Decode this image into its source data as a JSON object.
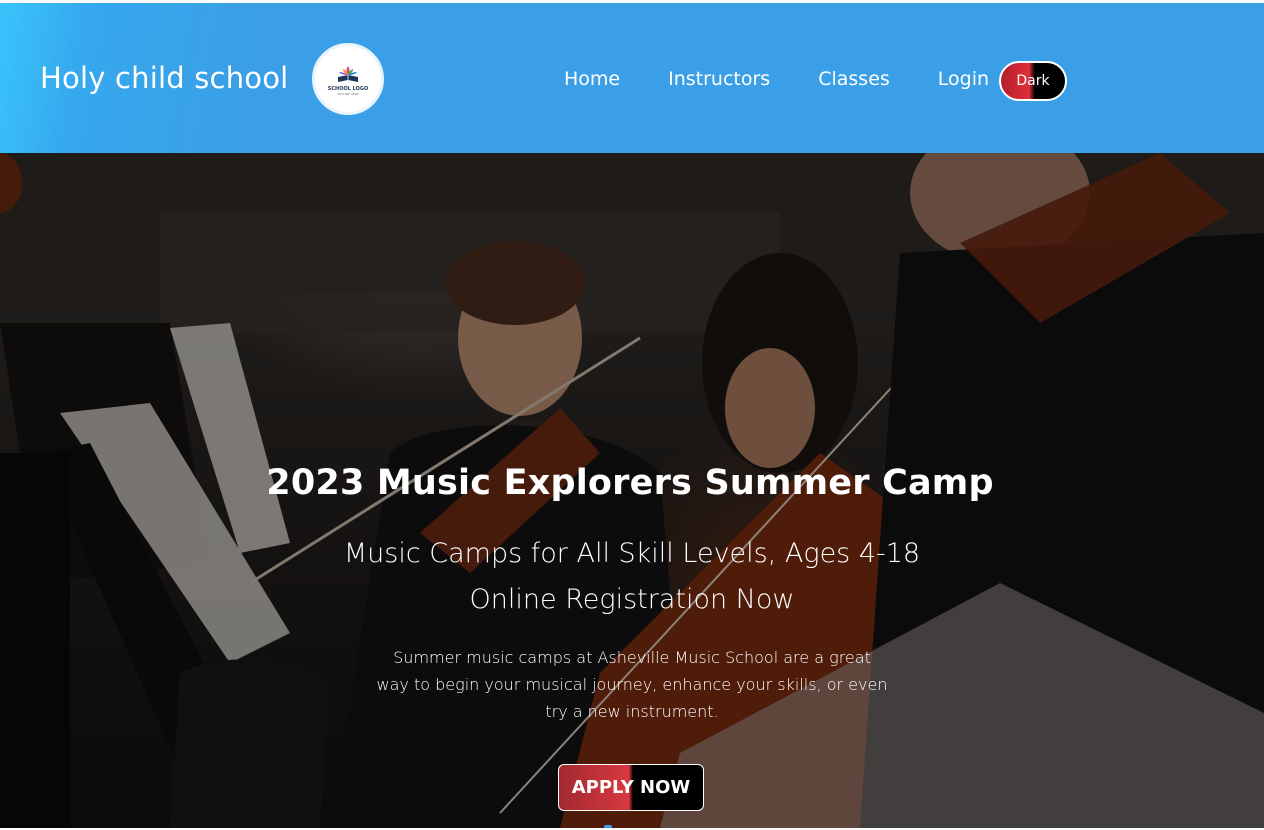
{
  "header": {
    "brand": "Holy child school",
    "logo": {
      "text": "SCHOOL LOGO",
      "sub": "TAGLINE HERE"
    },
    "nav": [
      {
        "label": "Home"
      },
      {
        "label": "Instructors"
      },
      {
        "label": "Classes"
      },
      {
        "label": "Login"
      }
    ],
    "dark_toggle_label": "Dark"
  },
  "hero": {
    "title": "2023 Music Explorers Summer Camp",
    "subtitle_line1": "Music Camps for All Skill Levels, Ages 4-18",
    "subtitle_line2": "Online Registration Now",
    "description": "Summer music camps at Asheville Music School are a great way to begin your musical journey, enhance your skills, or even try a new instrument.",
    "cta_label": "APPLY NOW"
  },
  "colors": {
    "header_bg": "#3a9fe6",
    "header_accent": "#39c4fb",
    "toggle_red": "#e0303b",
    "toggle_black": "#000000",
    "cta_red": "#d73840"
  }
}
